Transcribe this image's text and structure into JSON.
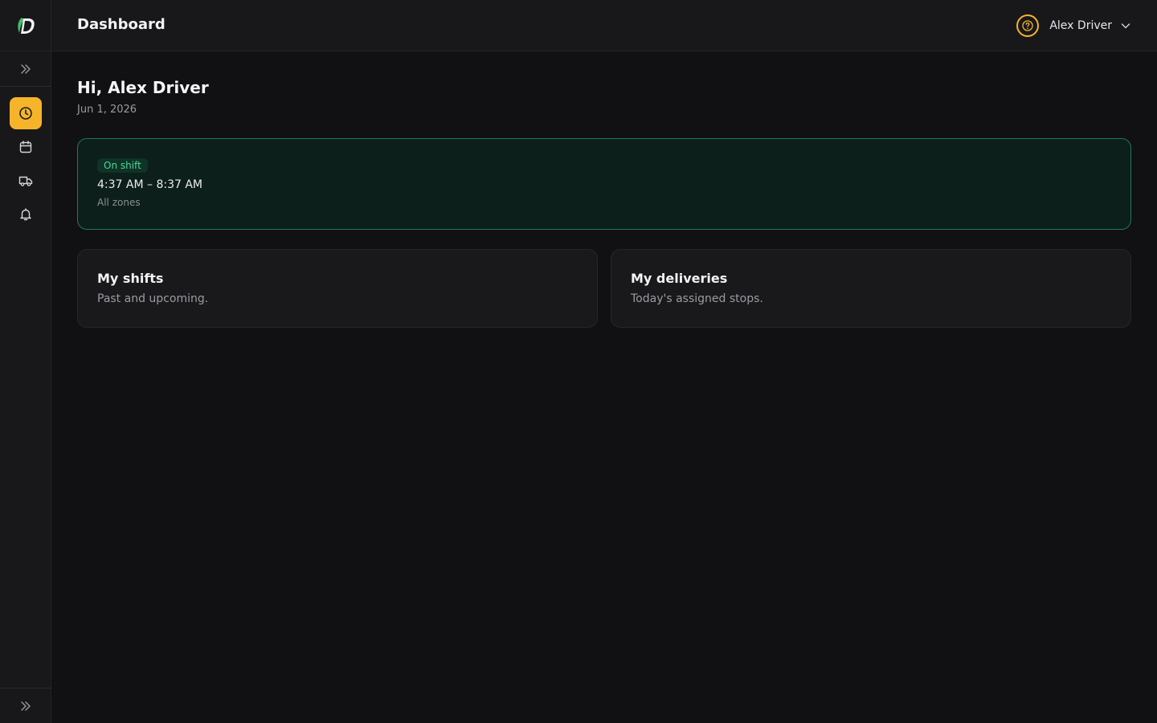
{
  "header": {
    "title": "Dashboard",
    "user_name": "Alex Driver"
  },
  "sidebar": {
    "items": [
      {
        "name": "clock-icon",
        "active": true
      },
      {
        "name": "calendar-icon",
        "active": false
      },
      {
        "name": "truck-icon",
        "active": false
      },
      {
        "name": "bell-icon",
        "active": false
      }
    ]
  },
  "main": {
    "greeting": "Hi, Alex Driver",
    "date": "Jun 1, 2026",
    "shift": {
      "status": "On shift",
      "time": "4:37 AM – 8:37 AM",
      "zone": "All zones"
    },
    "tiles": [
      {
        "title": "My shifts",
        "subtitle": "Past and upcoming."
      },
      {
        "title": "My deliveries",
        "subtitle": "Today's assigned stops."
      }
    ]
  },
  "colors": {
    "accent": "#f5b42a",
    "success": "#4fd49a",
    "success_border": "#1f7a55",
    "background": "#111113",
    "panel": "#18181b"
  }
}
